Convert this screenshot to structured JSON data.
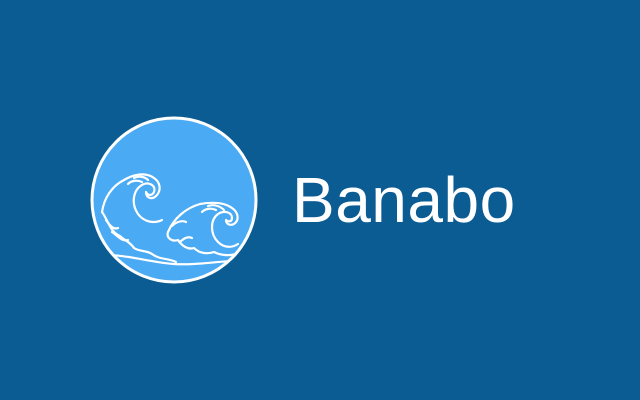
{
  "brand": {
    "name": "Banabo",
    "logo_icon": "wave-icon"
  },
  "colors": {
    "background": "#0b5c93",
    "logo_fill": "#4aaaf3",
    "logo_stroke": "#ffffff",
    "text": "#ffffff"
  }
}
